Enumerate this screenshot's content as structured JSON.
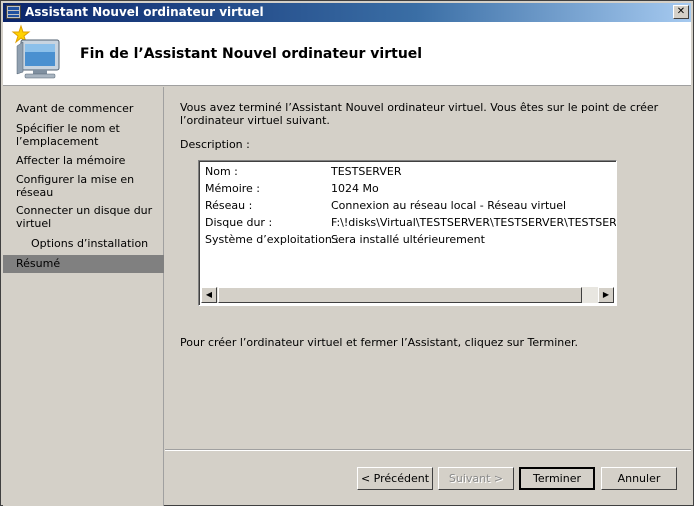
{
  "window": {
    "title": "Assistant Nouvel ordinateur virtuel",
    "close_symbol": "✕"
  },
  "header": {
    "title": "Fin de l’Assistant Nouvel ordinateur virtuel",
    "icon": "computer-wizard-icon"
  },
  "sidebar": {
    "items": [
      {
        "label": "Avant de commencer"
      },
      {
        "label": "Spécifier le nom et l’emplacement"
      },
      {
        "label": "Affecter la mémoire"
      },
      {
        "label": "Configurer la mise en réseau"
      },
      {
        "label": "Connecter un disque dur virtuel"
      },
      {
        "label": "Options d’installation"
      },
      {
        "label": "Résumé"
      }
    ],
    "active_index": 6
  },
  "main": {
    "intro": "Vous avez terminé l’Assistant Nouvel ordinateur virtuel. Vous êtes sur le point de créer l’ordinateur virtuel suivant.",
    "description_label": "Description :",
    "summary": [
      {
        "key": "Nom :",
        "value": "TESTSERVER"
      },
      {
        "key": "Mémoire :",
        "value": "1024 Mo"
      },
      {
        "key": "Réseau :",
        "value": "Connexion au réseau local - Réseau virtuel"
      },
      {
        "key": "Disque dur :",
        "value": "F:\\!disks\\Virtual\\TESTSERVER\\TESTSERVER\\TESTSERVER.vhd"
      },
      {
        "key": "Système d’exploitation :",
        "value": "Sera installé ultérieurement"
      }
    ],
    "footer": "Pour créer l’ordinateur virtuel et fermer l’Assistant, cliquez sur Terminer."
  },
  "buttons": {
    "previous": "< Précédent",
    "next": "Suivant >",
    "finish": "Terminer",
    "cancel": "Annuler"
  },
  "colors": {
    "titlebar_start": "#0a246a",
    "active_item_bg": "#808080",
    "dialog_bg": "#d4d0c8"
  }
}
